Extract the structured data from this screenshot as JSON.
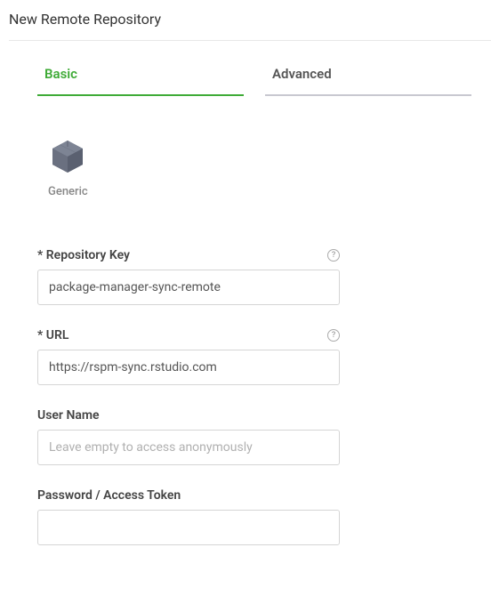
{
  "page_title": "New Remote Repository",
  "tabs": {
    "basic": "Basic",
    "advanced": "Advanced"
  },
  "repo_type": {
    "label": "Generic"
  },
  "fields": {
    "repo_key": {
      "label": "* Repository Key",
      "value": "package-manager-sync-remote"
    },
    "url": {
      "label": "* URL",
      "value": "https://rspm-sync.rstudio.com"
    },
    "username": {
      "label": "User Name",
      "value": "",
      "placeholder": "Leave empty to access anonymously"
    },
    "password": {
      "label": "Password / Access Token",
      "value": ""
    }
  }
}
